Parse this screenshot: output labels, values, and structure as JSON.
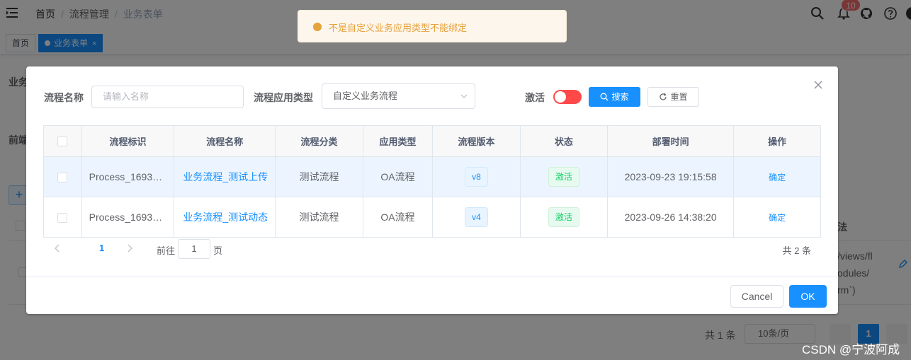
{
  "breadcrumb": {
    "home": "首页",
    "section": "流程管理",
    "current": "业务表单"
  },
  "notifications": {
    "badge": "10"
  },
  "tags": {
    "home": "首页",
    "active": "业务表单",
    "close": "×"
  },
  "background": {
    "label_top": "业务",
    "label_mid": "前端",
    "plus": "+",
    "col_header": "法",
    "row_text_1": "/views/fl",
    "row_text_2": "odules/",
    "row_text_3": "rm`)",
    "pager_total": "共 1 条",
    "page_size": "10条/页",
    "current_page": "1",
    "watermark": "CSDN @宁波阿成"
  },
  "message": {
    "text": "不是自定义业务应用类型不能绑定",
    "type": "warning"
  },
  "search": {
    "name_label": "流程名称",
    "name_placeholder": "请输入名称",
    "type_label": "流程应用类型",
    "type_value": "自定义业务流程",
    "active_label": "激活",
    "active_on": false,
    "search_button": "搜索",
    "reset_button": "重置"
  },
  "table": {
    "headers": [
      "流程标识",
      "流程名称",
      "流程分类",
      "应用类型",
      "流程版本",
      "状态",
      "部署时间",
      "操作"
    ],
    "rows": [
      {
        "key": "Process_1693…",
        "name": "业务流程_测试上传",
        "category": "测试流程",
        "app_type": "OA流程",
        "version": "v8",
        "status": "激活",
        "deploy_time": "2023-09-23 19:15:58",
        "action": "确定"
      },
      {
        "key": "Process_1693…",
        "name": "业务流程_测试动态",
        "category": "测试流程",
        "app_type": "OA流程",
        "version": "v4",
        "status": "激活",
        "deploy_time": "2023-09-26 14:38:20",
        "action": "确定"
      }
    ]
  },
  "pagination": {
    "current": "1",
    "goto_label": "前往",
    "goto_value": "1",
    "page_unit": "页",
    "total": "共 2 条"
  },
  "footer": {
    "cancel": "Cancel",
    "ok": "OK"
  },
  "colors": {
    "primary": "#1890ff",
    "warning": "#e6a23c",
    "danger": "#ff4949",
    "success": "#13ce66"
  }
}
